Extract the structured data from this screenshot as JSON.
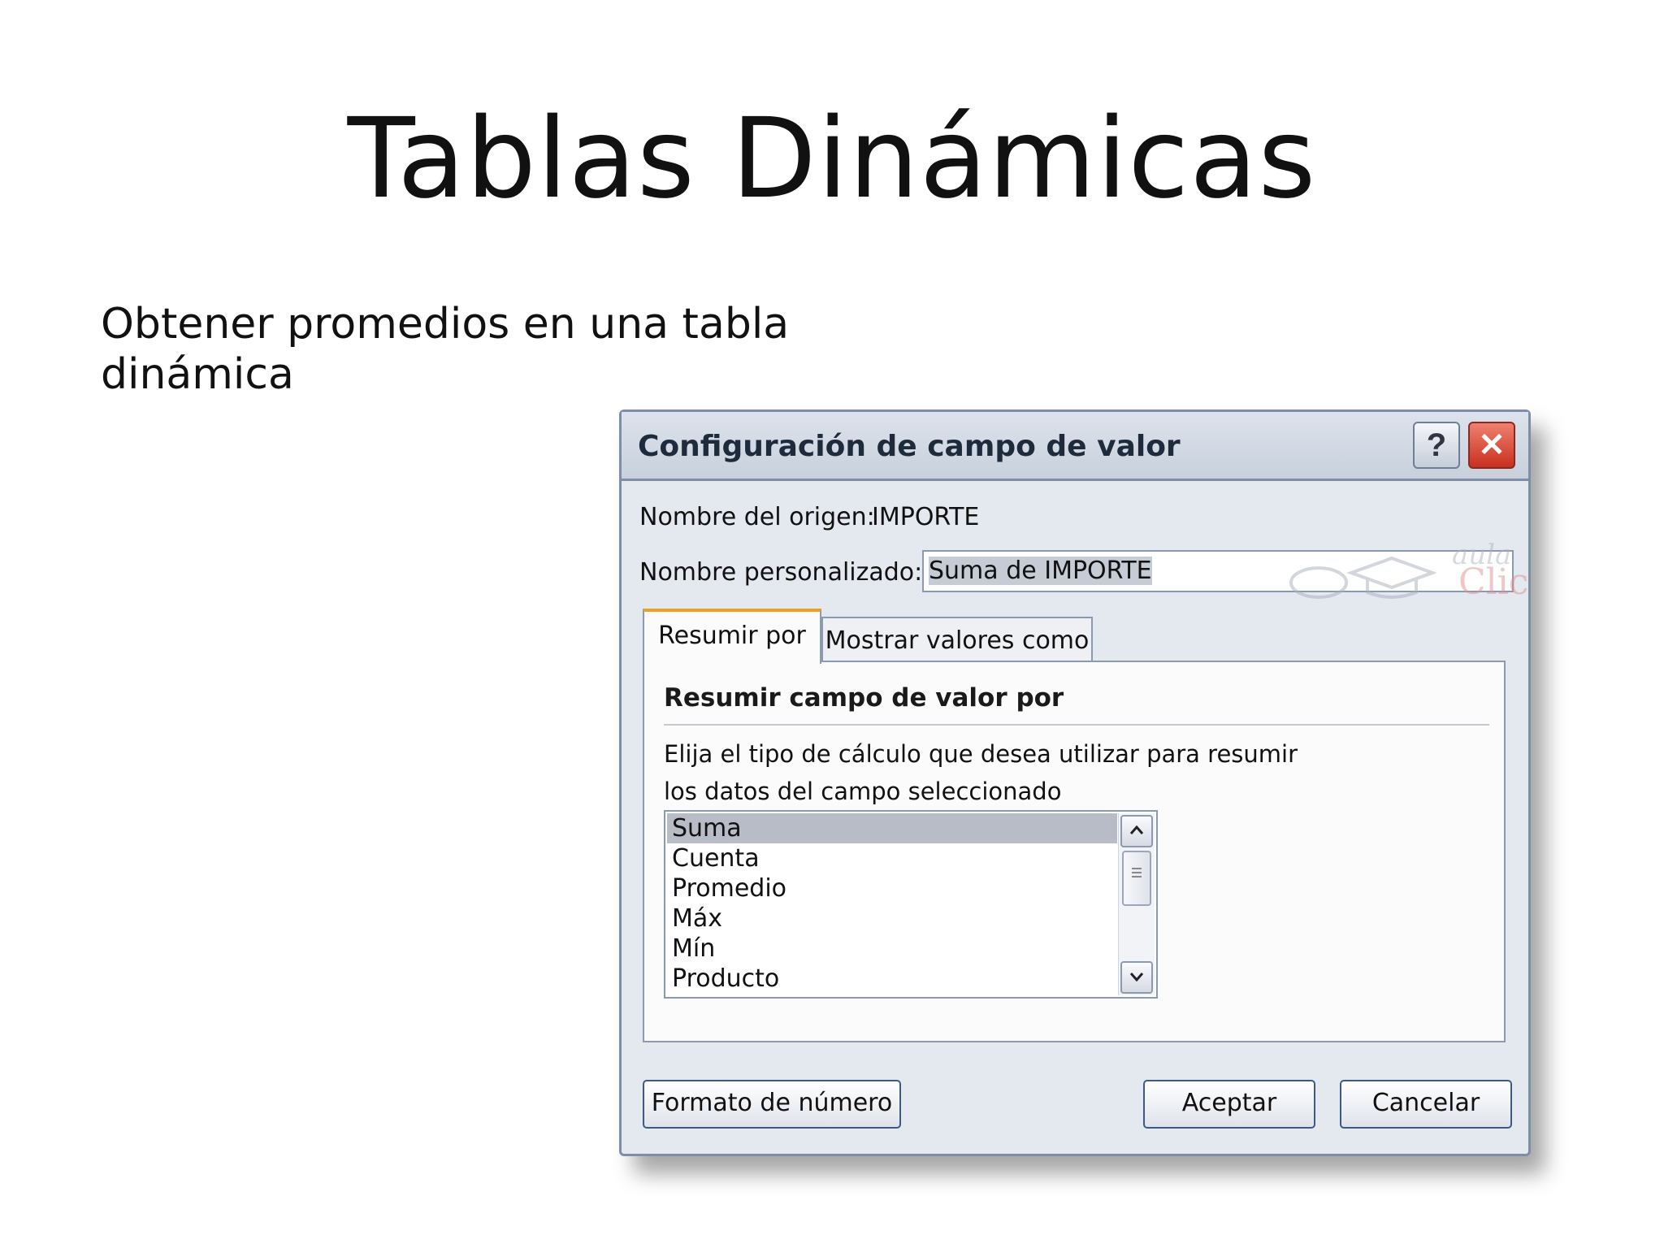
{
  "slide": {
    "title": "Tablas Dinámicas",
    "text_line1": "Obtener promedios en una tabla",
    "text_line2": "dinámica"
  },
  "dialog": {
    "title": "Configuración de campo de valor",
    "help_label": "?",
    "close_label": "✕",
    "origin_label": "Nombre del origen:",
    "origin_value": "IMPORTE",
    "custom_label": "Nombre personalizado:",
    "custom_value": "Suma de IMPORTE",
    "tabs": [
      {
        "label": "Resumir por",
        "active": true
      },
      {
        "label": "Mostrar valores como",
        "active": false
      }
    ],
    "panel": {
      "heading": "Resumir campo de valor por",
      "desc_line1": "Elija el tipo de cálculo que desea utilizar para resumir",
      "desc_line2": "los datos del campo seleccionado",
      "list_items": [
        "Suma",
        "Cuenta",
        "Promedio",
        "Máx",
        "Mín",
        "Producto"
      ],
      "selected_item": "Suma"
    },
    "buttons": {
      "format": "Formato de número",
      "ok": "Aceptar",
      "cancel": "Cancelar"
    },
    "watermark": {
      "aula": "aula",
      "clic": "Clic"
    }
  }
}
